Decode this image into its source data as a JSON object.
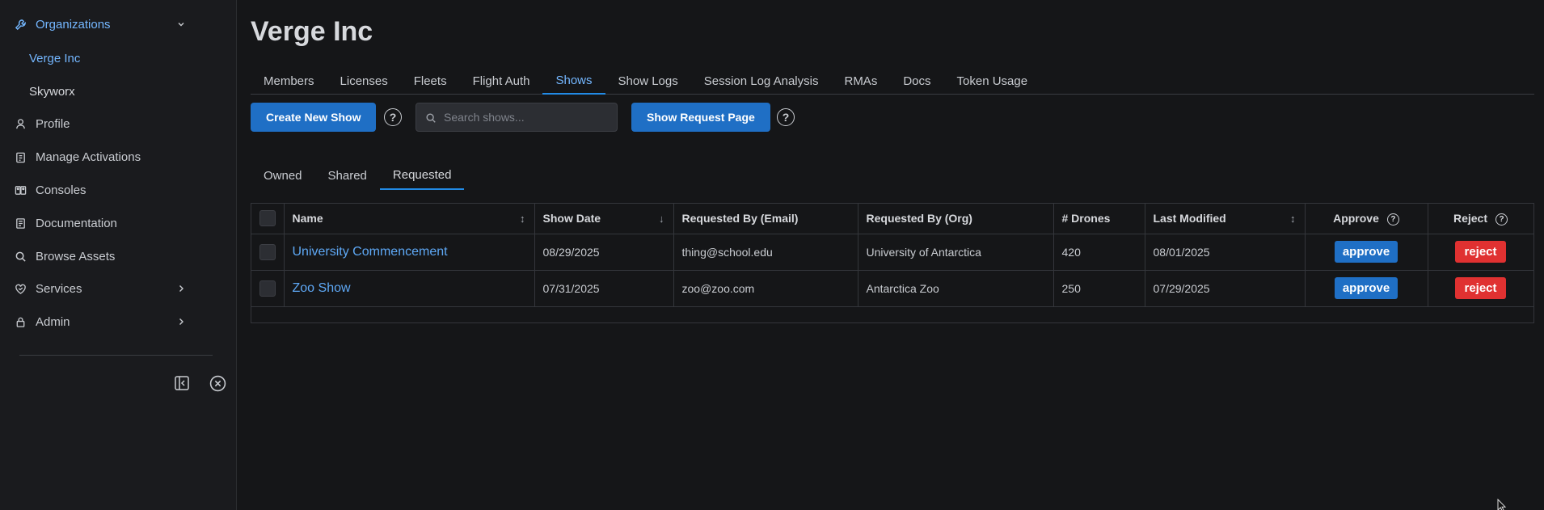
{
  "sidebar": {
    "organizations_label": "Organizations",
    "orgs": [
      "Verge Inc",
      "Skyworx"
    ],
    "items": [
      {
        "label": "Profile",
        "icon": "user-icon"
      },
      {
        "label": "Manage Activations",
        "icon": "clipboard-icon"
      },
      {
        "label": "Consoles",
        "icon": "consoles-icon"
      },
      {
        "label": "Documentation",
        "icon": "document-icon"
      },
      {
        "label": "Browse Assets",
        "icon": "search-icon"
      },
      {
        "label": "Services",
        "icon": "heart-handshake-icon"
      },
      {
        "label": "Admin",
        "icon": "lock-icon"
      }
    ]
  },
  "page": {
    "title": "Verge Inc"
  },
  "tabs": [
    "Members",
    "Licenses",
    "Fleets",
    "Flight Auth",
    "Shows",
    "Show Logs",
    "Session Log Analysis",
    "RMAs",
    "Docs",
    "Token Usage"
  ],
  "active_tab": "Shows",
  "toolbar": {
    "create_label": "Create New Show",
    "search_placeholder": "Search shows...",
    "request_page_label": "Show Request Page"
  },
  "subtabs": [
    "Owned",
    "Shared",
    "Requested"
  ],
  "active_subtab": "Requested",
  "table": {
    "headers": {
      "name": "Name",
      "show_date": "Show Date",
      "requested_email": "Requested By (Email)",
      "requested_org": "Requested By (Org)",
      "drones": "# Drones",
      "last_modified": "Last Modified",
      "approve": "Approve",
      "reject": "Reject"
    },
    "rows": [
      {
        "name": "University Commencement",
        "show_date": "08/29/2025",
        "email": "thing@school.edu",
        "org": "University of Antarctica",
        "drones": "420",
        "last_modified": "08/01/2025",
        "approve": "approve",
        "reject": "reject"
      },
      {
        "name": "Zoo Show",
        "show_date": "07/31/2025",
        "email": "zoo@zoo.com",
        "org": "Antarctica Zoo",
        "drones": "250",
        "last_modified": "07/29/2025",
        "approve": "approve",
        "reject": "reject"
      }
    ]
  },
  "colors": {
    "accent": "#228be6",
    "approve": "#1f6fc5",
    "reject": "#e03131",
    "link": "#5ea8f5"
  }
}
